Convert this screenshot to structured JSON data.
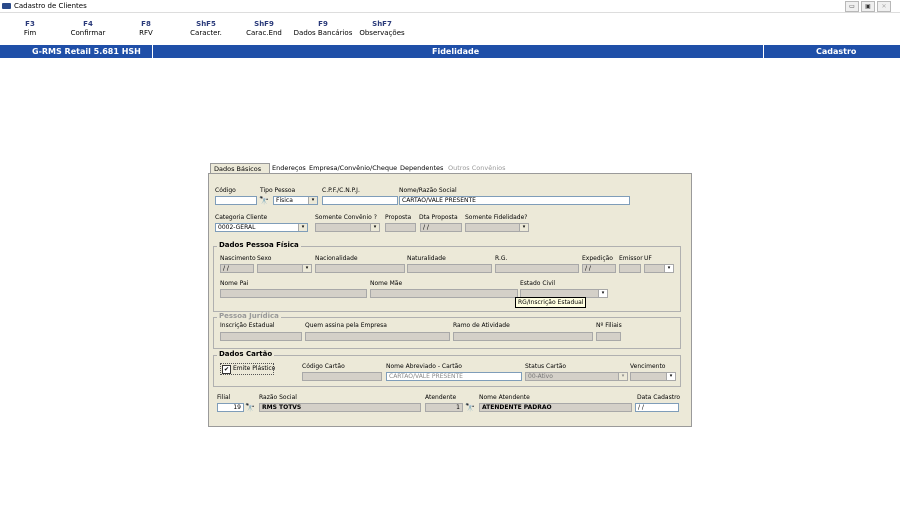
{
  "window": {
    "title": "Cadastro de Clientes",
    "buttons": [
      "▭",
      "▣",
      "✕"
    ]
  },
  "toolbar": [
    {
      "key": "F3",
      "label": "Fim"
    },
    {
      "key": "F4",
      "label": "Confirmar"
    },
    {
      "key": "F8",
      "label": "RFV"
    },
    {
      "key": "ShF5",
      "label": "Caracter."
    },
    {
      "key": "ShF9",
      "label": "Carac.End"
    },
    {
      "key": "F9",
      "label": "Dados Bancários"
    },
    {
      "key": "ShF7",
      "label": "Observações"
    }
  ],
  "statusbar": {
    "version": "G-RMS Retail 5.681 HSH",
    "module": "Fidelidade",
    "mode": "Cadastro"
  },
  "tabs": [
    "Dados Básicos",
    "Endereços",
    "Empresa/Convênio/Cheque",
    "Dependentes",
    "Outros Convênios"
  ],
  "row1": {
    "codigo_label": "Código",
    "codigo_value": "",
    "tipo_label": "Tipo Pessoa",
    "tipo_value": "Física",
    "cpf_label": "C.P.F./C.N.P.J.",
    "cpf_value": "",
    "nome_label": "Nome/Razão Social",
    "nome_value": "CARTÃO/VALE PRESENTE"
  },
  "row2": {
    "categoria_label": "Categoria Cliente",
    "categoria_value": "0002-GERAL",
    "convenio_label": "Somente Convênio ?",
    "convenio_value": "",
    "proposta_label": "Proposta",
    "proposta_value": "",
    "dtproposta_label": "Dta Proposta",
    "dtproposta_value": "/ /",
    "fidelidade_label": "Somente Fidelidade?",
    "fidelidade_value": ""
  },
  "pf": {
    "title": "Dados Pessoa Física",
    "nascimento_label": "Nascimento",
    "nascimento_value": "/ /",
    "sexo_label": "Sexo",
    "nacionalidade_label": "Nacionalidade",
    "naturalidade_label": "Naturalidade",
    "rg_label": "R.G.",
    "expedicao_label": "Expedição",
    "expedicao_value": "/ /",
    "emissor_label": "Emissor",
    "uf_label": "UF",
    "pai_label": "Nome Pai",
    "mae_label": "Nome Mãe",
    "estadocivil_label": "Estado Civil",
    "tooltip": "RG/Inscrição Estadual"
  },
  "pj": {
    "title": "Pessoa Jurídica",
    "ie_label": "Inscrição Estadual",
    "assina_label": "Quem assina pela Empresa",
    "ramo_label": "Ramo de Atividade",
    "filiais_label": "Nº Filiais"
  },
  "cartao": {
    "title": "Dados Cartão",
    "emite_label": "Emite Plástico",
    "emite_checked": "✔",
    "codigo_label": "Código Cartão",
    "nomeabrev_label": "Nome Abreviado - Cartão",
    "nomeabrev_value": "CARTÃO/VALE PRESENTE",
    "status_label": "Status Cartão",
    "status_value": "00-Ativo",
    "venc_label": "Vencimento"
  },
  "footer": {
    "filial_label": "Filial",
    "filial_value": "19",
    "razao_label": "Razão Social",
    "razao_value": "RMS TOTVS",
    "atendente_label": "Atendente",
    "atendente_value": "1",
    "nomeatend_label": "Nome Atendente",
    "nomeatend_value": "ATENDENTE PADRAO",
    "datacad_label": "Data Cadastro",
    "datacad_value": "/ /"
  },
  "icons": {
    "binoculars": "🔭",
    "dropdown": "▾"
  },
  "colors": {
    "statusbar_bg": "#1f4fa8",
    "fkey_text": "#2a3a7a",
    "dialog_bg": "#ece9d8"
  }
}
